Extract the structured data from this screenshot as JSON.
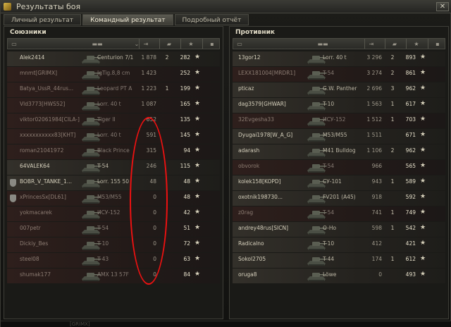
{
  "window": {
    "title": "Результаты боя",
    "close": "✕"
  },
  "tabs": [
    {
      "label": "Личный результат"
    },
    {
      "label": "Командный результат"
    },
    {
      "label": "Подробный отчёт"
    }
  ],
  "allies": {
    "title": "Союзники",
    "rows": [
      {
        "player": "Alek2414",
        "tank": "Centurion 7/1",
        "damage": "1 878",
        "kills": "2",
        "xp": "282",
        "destroyed": false
      },
      {
        "player": "mnmt[GRIMX]",
        "tank": "JgTig.8,8 cm",
        "damage": "1 423",
        "kills": "",
        "xp": "252",
        "destroyed": true
      },
      {
        "player": "Batya_UssR_44rus...",
        "tank": "Leopard PT A",
        "damage": "1 223",
        "kills": "1",
        "xp": "199",
        "destroyed": true
      },
      {
        "player": "Vld3773[HWS52]",
        "tank": "Lorr. 40 t",
        "damage": "1 087",
        "kills": "",
        "xp": "165",
        "destroyed": true
      },
      {
        "player": "viktor02061984[CILA-]",
        "tank": "Tiger II",
        "damage": "652",
        "kills": "",
        "xp": "135",
        "destroyed": true
      },
      {
        "player": "xxxxxxxxxxx83[KHT]",
        "tank": "Lorr. 40 t",
        "damage": "591",
        "kills": "",
        "xp": "145",
        "destroyed": true
      },
      {
        "player": "roman21041972",
        "tank": "Black Prince",
        "damage": "315",
        "kills": "",
        "xp": "94",
        "destroyed": true
      },
      {
        "player": "64VALEK64",
        "tank": "T-54",
        "damage": "246",
        "kills": "",
        "xp": "115",
        "destroyed": false
      },
      {
        "player": "BOBR_V_TANKE_1...",
        "tank": "Lorr. 155 50",
        "damage": "48",
        "kills": "",
        "xp": "48",
        "destroyed": false,
        "flag": true
      },
      {
        "player": "xPrincesSx[DL61]",
        "tank": "M53/M55",
        "damage": "0",
        "kills": "",
        "xp": "48",
        "destroyed": true,
        "flag": true
      },
      {
        "player": "yokmacarek",
        "tank": "ИСУ-152",
        "damage": "0",
        "kills": "",
        "xp": "42",
        "destroyed": true
      },
      {
        "player": "007petr",
        "tank": "T-54",
        "damage": "0",
        "kills": "",
        "xp": "51",
        "destroyed": true
      },
      {
        "player": "Dickiy_Bes",
        "tank": "T-10",
        "damage": "0",
        "kills": "",
        "xp": "72",
        "destroyed": true
      },
      {
        "player": "steel08",
        "tank": "T-43",
        "damage": "0",
        "kills": "",
        "xp": "63",
        "destroyed": true
      },
      {
        "player": "shumak177",
        "tank": "AMX 13 57F",
        "damage": "0",
        "kills": "",
        "xp": "84",
        "destroyed": true
      }
    ]
  },
  "enemies": {
    "title": "Противник",
    "rows": [
      {
        "player": "13gor12",
        "tank": "Lorr. 40 t",
        "damage": "3 296",
        "kills": "2",
        "xp": "893",
        "destroyed": false
      },
      {
        "player": "LEXX181004[MRDR1]",
        "tank": "T-54",
        "damage": "3 274",
        "kills": "2",
        "xp": "861",
        "destroyed": true
      },
      {
        "player": "pticaz",
        "tank": "G.W. Panther",
        "damage": "2 696",
        "kills": "3",
        "xp": "962",
        "destroyed": false
      },
      {
        "player": "dag3579[GHWAR]",
        "tank": "T-10",
        "damage": "1 563",
        "kills": "1",
        "xp": "617",
        "destroyed": false
      },
      {
        "player": "32Evgesha33",
        "tank": "ИСУ-152",
        "damage": "1 512",
        "kills": "1",
        "xp": "703",
        "destroyed": true
      },
      {
        "player": "Dyugai1978[W_A_G]",
        "tank": "M53/M55",
        "damage": "1 511",
        "kills": "",
        "xp": "671",
        "destroyed": false
      },
      {
        "player": "adarash",
        "tank": "M41 Bulldog",
        "damage": "1 106",
        "kills": "2",
        "xp": "962",
        "destroyed": false
      },
      {
        "player": "obvorok",
        "tank": "T-54",
        "damage": "966",
        "kills": "",
        "xp": "565",
        "destroyed": true
      },
      {
        "player": "kolek158[KOPD]",
        "tank": "СУ-101",
        "damage": "943",
        "kills": "1",
        "xp": "589",
        "destroyed": false
      },
      {
        "player": "oxotnik198730...",
        "tank": "FV201 (A45)",
        "damage": "918",
        "kills": "",
        "xp": "592",
        "destroyed": false
      },
      {
        "player": "z0rag",
        "tank": "T-54",
        "damage": "741",
        "kills": "1",
        "xp": "749",
        "destroyed": true
      },
      {
        "player": "andrey48rus[SICN]",
        "tank": "O-Ho",
        "damage": "598",
        "kills": "1",
        "xp": "542",
        "destroyed": false
      },
      {
        "player": "Radicalno",
        "tank": "T-10",
        "damage": "412",
        "kills": "",
        "xp": "421",
        "destroyed": false
      },
      {
        "player": "Sokol2705",
        "tank": "T-44",
        "damage": "174",
        "kills": "1",
        "xp": "612",
        "destroyed": false
      },
      {
        "player": "oruga8",
        "tank": "Löwe",
        "damage": "0",
        "kills": "",
        "xp": "493",
        "destroyed": false
      }
    ]
  },
  "bottom": {
    "text": "[GRIMX]"
  },
  "colors": {
    "ellipse": "#ee1111",
    "accent": "#f0ead6"
  }
}
